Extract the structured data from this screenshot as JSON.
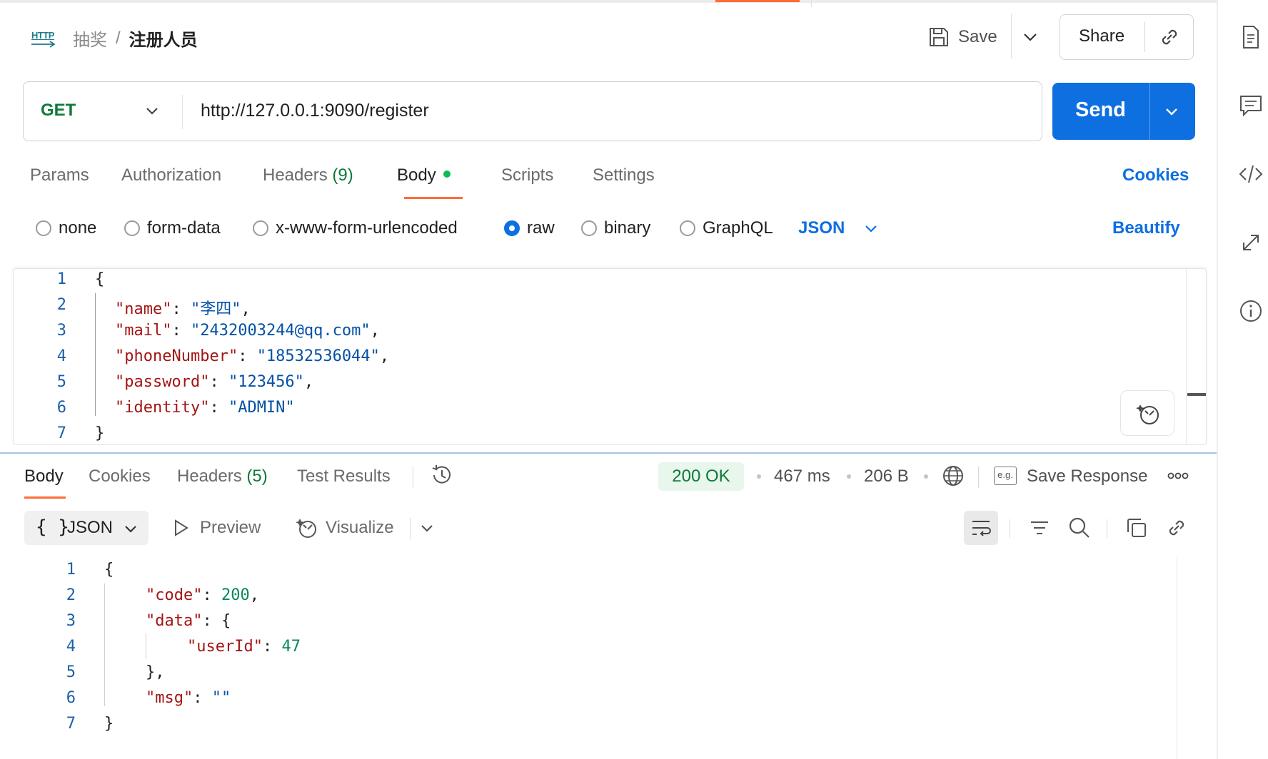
{
  "header": {
    "protocol_icon": "http-icon",
    "protocol_text": "HTTP",
    "breadcrumb_parent": "抽奖",
    "breadcrumb_separator": "/",
    "title": "注册人员",
    "save_label": "Save",
    "share_label": "Share"
  },
  "request": {
    "method": "GET",
    "url": "http://127.0.0.1:9090/register",
    "send_label": "Send"
  },
  "request_tabs": {
    "params": "Params",
    "authorization": "Authorization",
    "headers": "Headers",
    "headers_count": "(9)",
    "body": "Body",
    "scripts": "Scripts",
    "settings": "Settings",
    "cookies": "Cookies",
    "active": "Body"
  },
  "body_options": {
    "modes": [
      "none",
      "form-data",
      "x-www-form-urlencoded",
      "raw",
      "binary",
      "GraphQL"
    ],
    "selected": "raw",
    "format": "JSON",
    "beautify": "Beautify"
  },
  "request_body": {
    "line_numbers": [
      "1",
      "2",
      "3",
      "4",
      "5",
      "6",
      "7"
    ],
    "open": "{",
    "close": "}",
    "fields": [
      {
        "key": "\"name\"",
        "value": "\"李四\"",
        "trail": ","
      },
      {
        "key": "\"mail\"",
        "value": "\"2432003244@qq.com\"",
        "trail": ","
      },
      {
        "key": "\"phoneNumber\"",
        "value": "\"18532536044\"",
        "trail": ","
      },
      {
        "key": "\"password\"",
        "value": "\"123456\"",
        "trail": ","
      },
      {
        "key": "\"identity\"",
        "value": "\"ADMIN\"",
        "trail": ""
      }
    ]
  },
  "response_tabs": {
    "body": "Body",
    "cookies": "Cookies",
    "headers": "Headers",
    "headers_count": "(5)",
    "test_results": "Test Results",
    "active": "Body"
  },
  "response_meta": {
    "status": "200 OK",
    "time": "467 ms",
    "size": "206 B",
    "save_response": "Save Response",
    "eg_icon_text": "e.g.",
    "status_color": "#0f7a3a"
  },
  "response_toolbar": {
    "format_braces": "{ }",
    "format": "JSON",
    "preview": "Preview",
    "visualize": "Visualize"
  },
  "response_body": {
    "line_numbers": [
      "1",
      "2",
      "3",
      "4",
      "5",
      "6",
      "7"
    ],
    "l1": "{",
    "code_key": "\"code\"",
    "code_val": "200",
    "data_key": "\"data\"",
    "data_open": "{",
    "userid_key": "\"userId\"",
    "userid_val": "47",
    "data_close": "},",
    "msg_key": "\"msg\"",
    "msg_val": "\"\"",
    "l7": "}"
  },
  "colors": {
    "accent": "#ff6c37",
    "primary": "#0d6fe0",
    "method_get": "#0f7a3a"
  },
  "icons": {
    "rail": [
      "document-icon",
      "comment-icon",
      "code-icon",
      "related-icon",
      "info-icon"
    ]
  }
}
